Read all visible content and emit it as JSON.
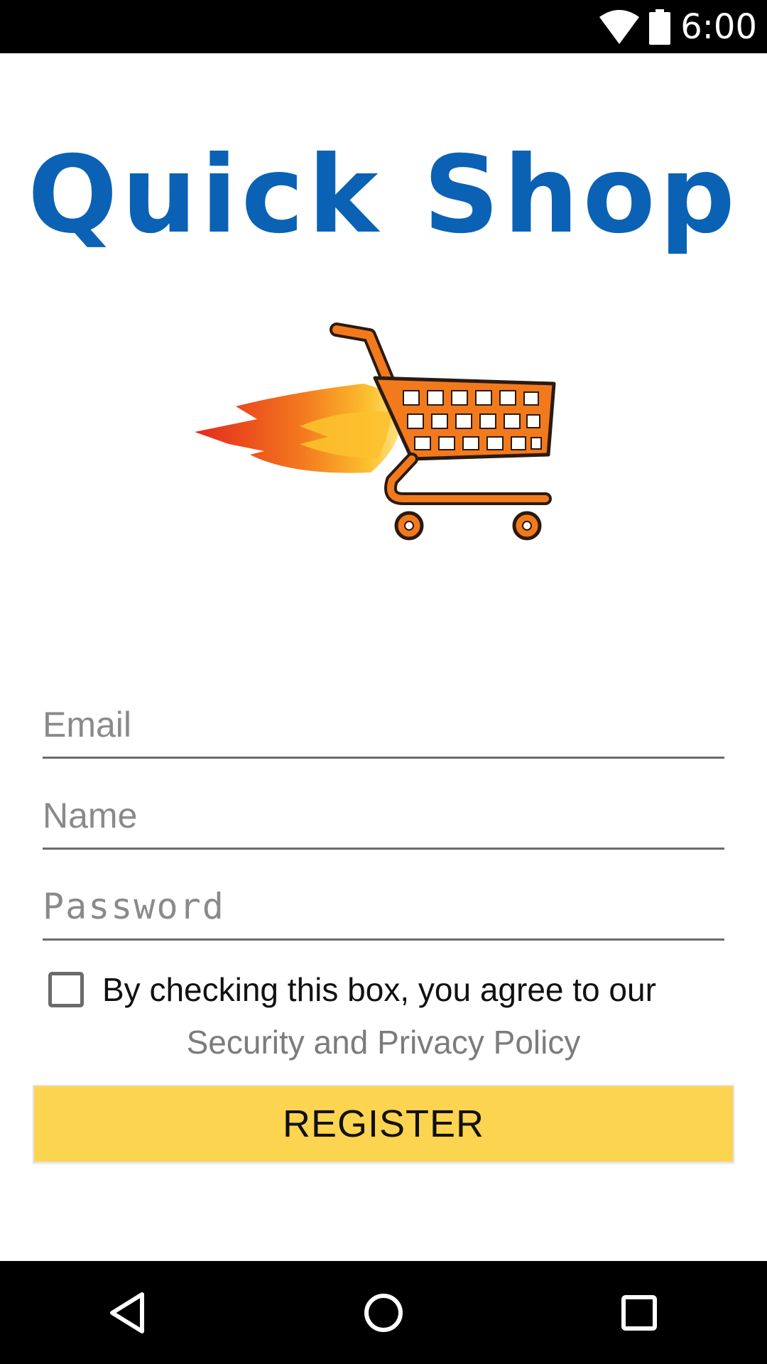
{
  "status_bar": {
    "time": "6:00",
    "icons": [
      "wifi-icon",
      "battery-icon"
    ]
  },
  "logo": {
    "text": "Quick Shop",
    "color": "#0b62b4",
    "image": "shopping-cart-flame-icon"
  },
  "form": {
    "email_placeholder": "Email",
    "email_value": "",
    "name_placeholder": "Name",
    "name_value": "",
    "password_placeholder": "Password",
    "password_value": "",
    "agree_checked": false,
    "agree_label": "By checking this box, you agree to our",
    "policy_link": "Security and Privacy Policy",
    "register_label": "REGISTER"
  },
  "colors": {
    "register_button": "#fdd450",
    "policy_link": "#7c7c7c"
  },
  "nav_bar": {
    "buttons": [
      "back-icon",
      "home-icon",
      "recents-icon"
    ]
  }
}
